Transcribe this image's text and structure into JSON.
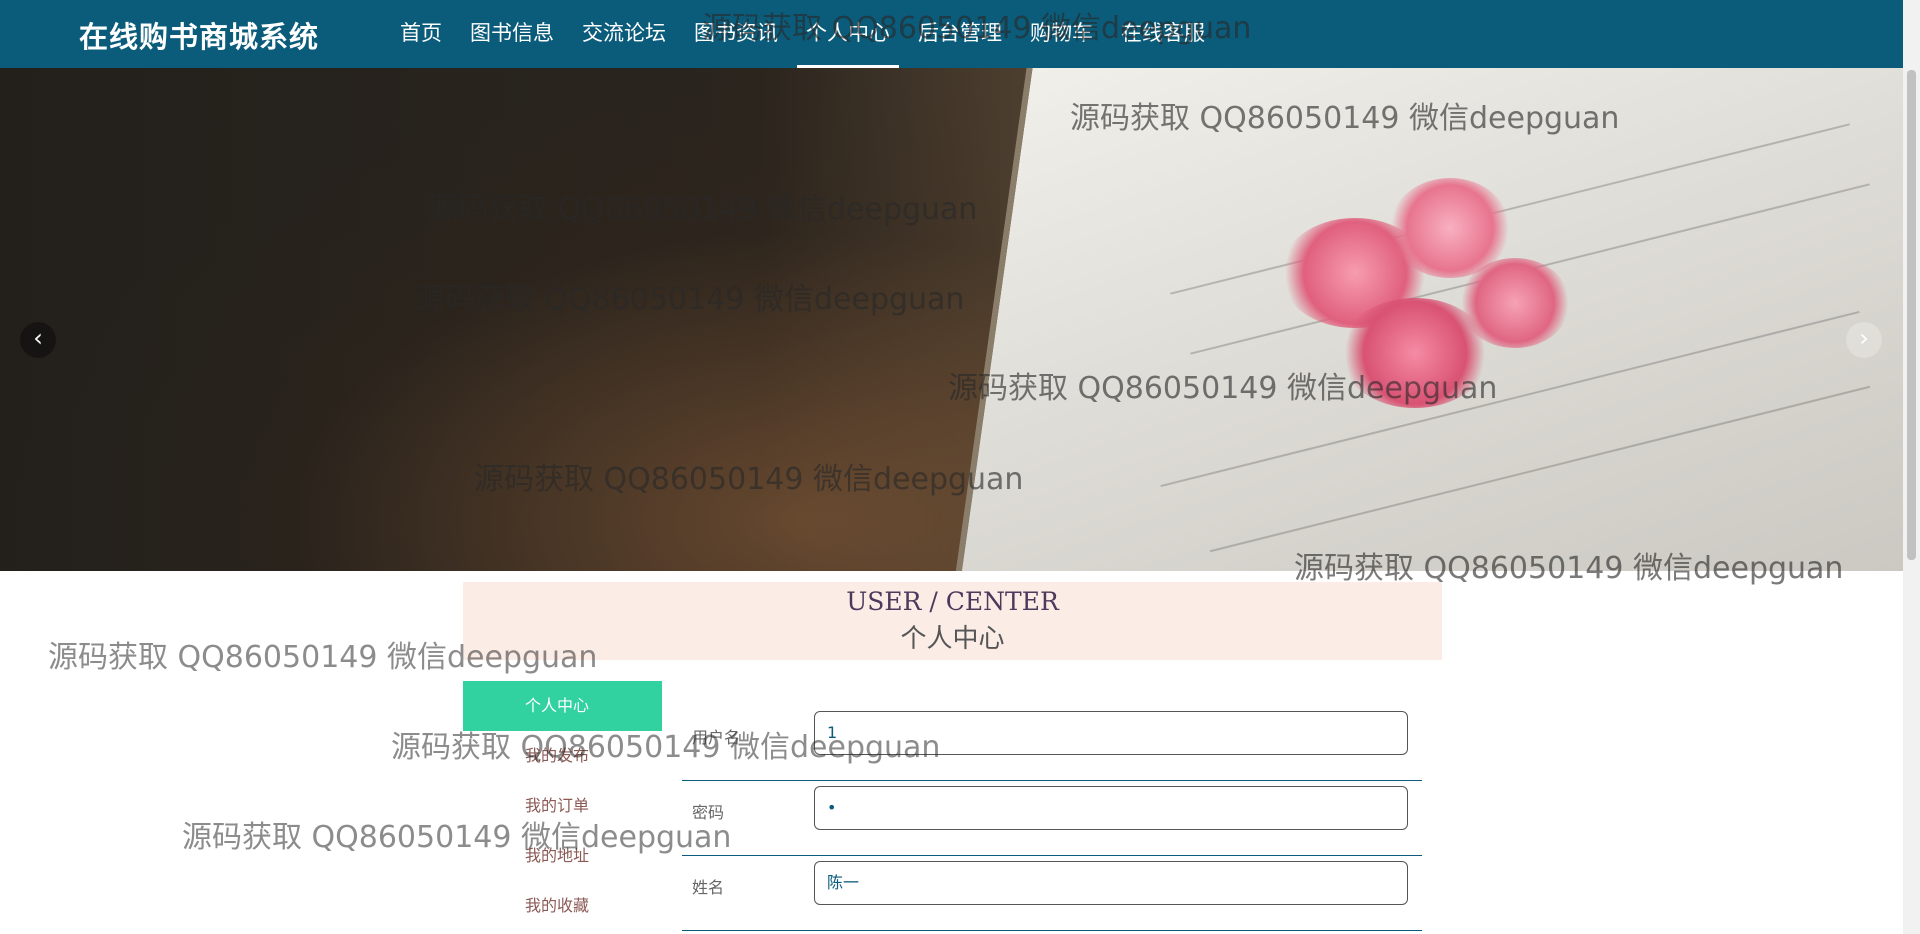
{
  "navbar": {
    "brand": "在线购书商城系统",
    "items": [
      {
        "label": "首页"
      },
      {
        "label": "图书信息"
      },
      {
        "label": "交流论坛"
      },
      {
        "label": "图书资讯"
      },
      {
        "label": "个人中心",
        "active": true
      },
      {
        "label": "后台管理"
      },
      {
        "label": "购物车"
      },
      {
        "label": "在线客服"
      }
    ]
  },
  "carousel": {
    "prev_icon": "chevron-left-icon",
    "next_icon": "chevron-right-icon",
    "slides": 3,
    "active_slide": 1
  },
  "watermark_text": "源码获取 QQ86050149 微信deepguan",
  "section": {
    "title_en": "USER / CENTER",
    "title_cn": "个人中心"
  },
  "side_menu": [
    {
      "label": "个人中心",
      "active": true
    },
    {
      "label": "我的发布"
    },
    {
      "label": "我的订单"
    },
    {
      "label": "我的地址"
    },
    {
      "label": "我的收藏"
    }
  ],
  "form": {
    "fields": [
      {
        "label": "用户名",
        "value": "1"
      },
      {
        "label": "密码",
        "value": "•"
      },
      {
        "label": "姓名",
        "value": "陈一"
      }
    ]
  },
  "colors": {
    "navbar": "#0b5c7b",
    "side_active": "#32d1a0",
    "title_bg": "#fbece6"
  }
}
